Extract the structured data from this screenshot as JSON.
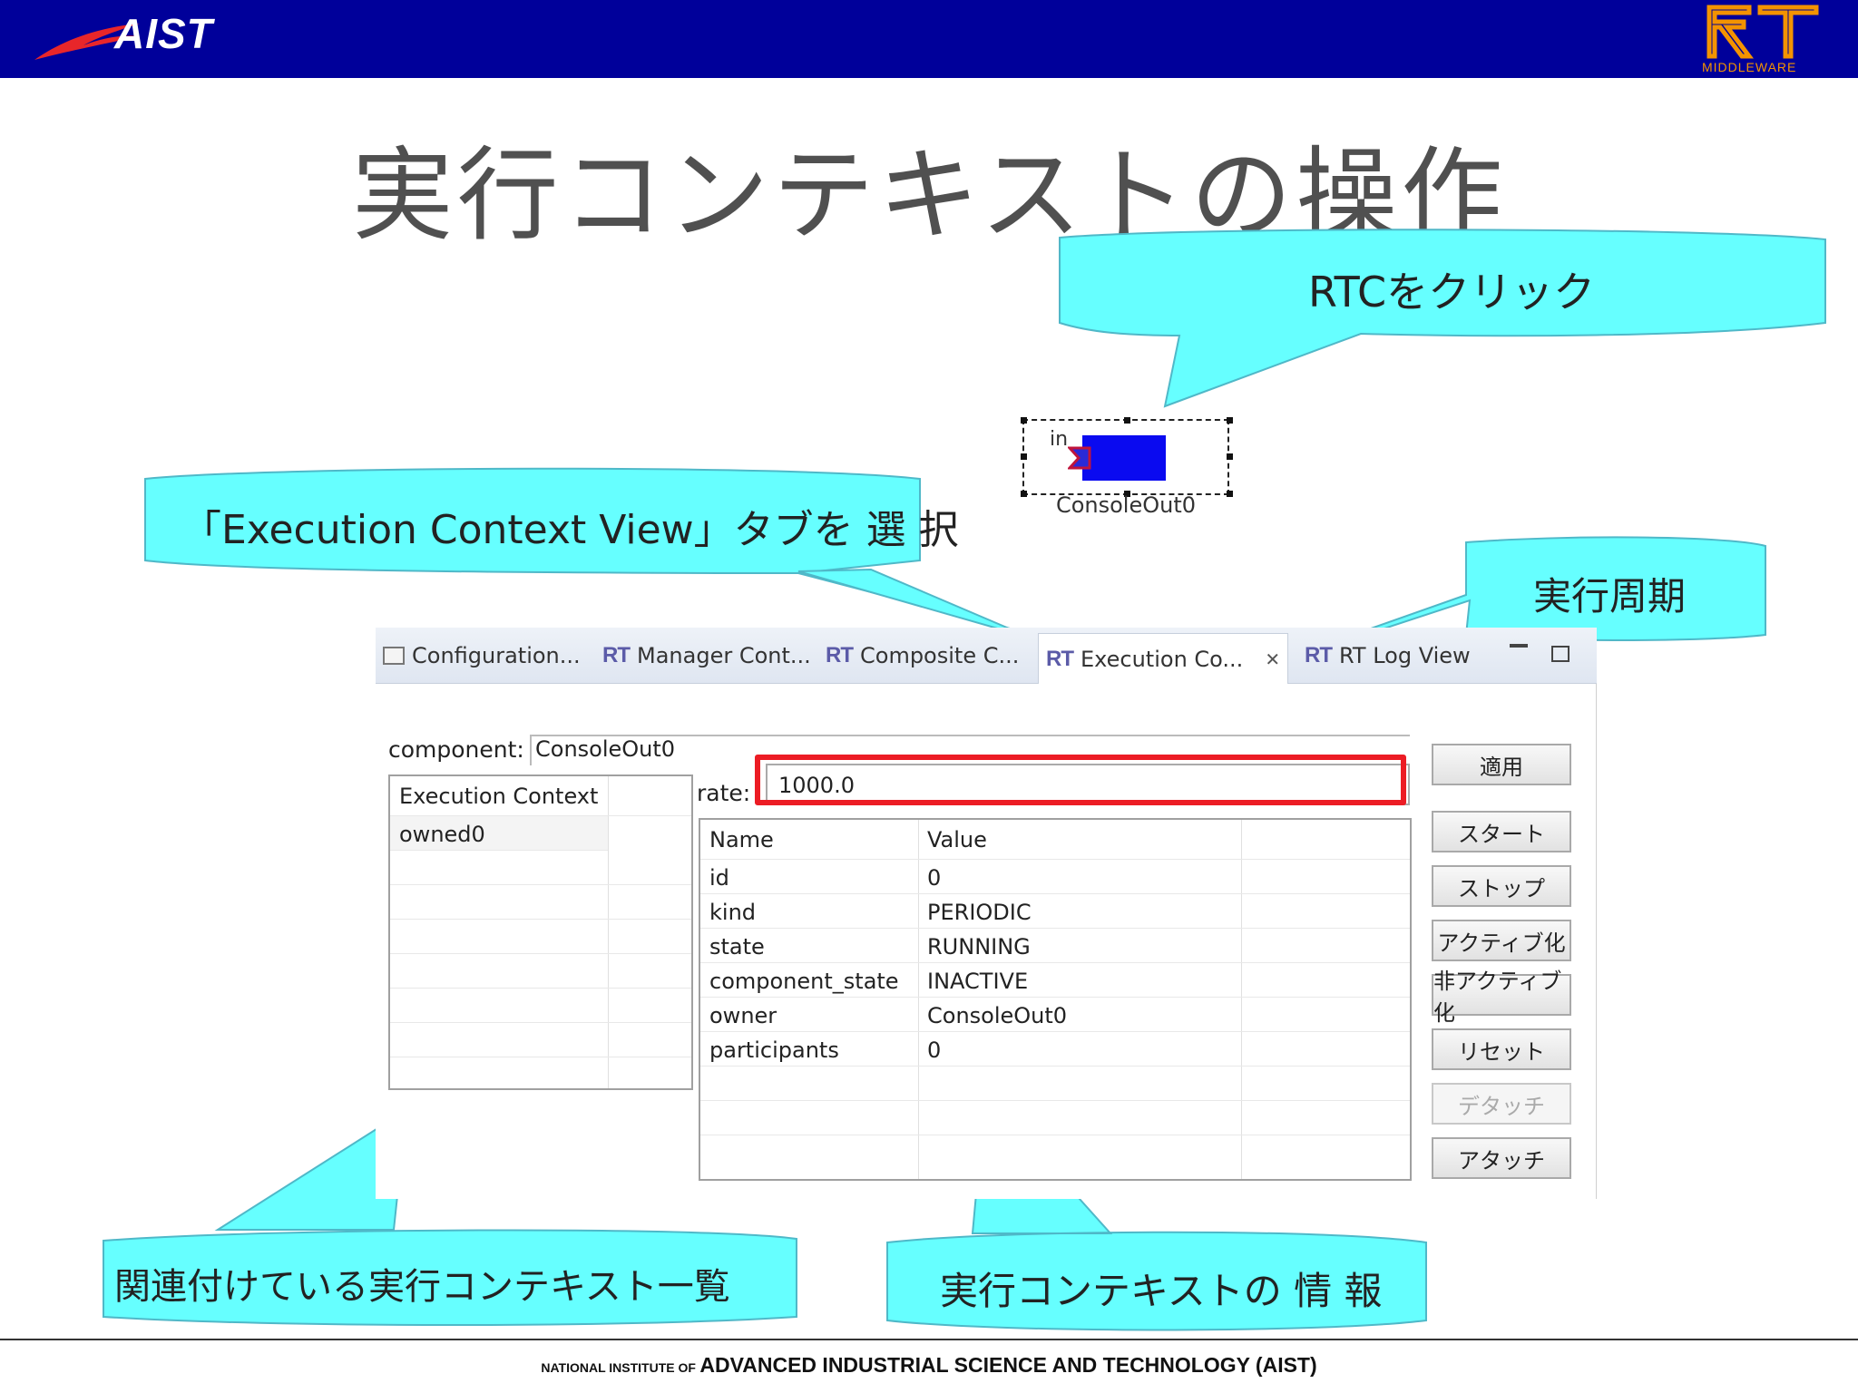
{
  "header": {
    "org_logo": "AIST",
    "rt_logo_sub": "MIDDLEWARE"
  },
  "slide": {
    "title": "実行コンテキストの操作"
  },
  "callouts": {
    "click_rtc": "RTCをクリック",
    "select_tab": "「Execution Context View」タブを 選 択",
    "period": "実行周期",
    "ec_list": "関連付けている実行コンテキスト一覧",
    "ec_info": "実行コンテキストの 情 報"
  },
  "rtc": {
    "port_label": "in",
    "name": "ConsoleOut0",
    "body_color": "#0a0af0"
  },
  "tabs": [
    {
      "label": "Configuration...",
      "icon": "config-icon"
    },
    {
      "label": "Manager Cont...",
      "icon": "rt-icon"
    },
    {
      "label": "Composite C...",
      "icon": "rt-icon"
    },
    {
      "label": "Execution Co...",
      "icon": "rt-icon",
      "active": true
    },
    {
      "label": "RT Log View",
      "icon": "rt-icon"
    }
  ],
  "rt_badge": "RT",
  "close_glyph": "✕",
  "form": {
    "component_label": "component:",
    "component_value": "ConsoleOut0",
    "rate_label": "rate:",
    "rate_value": "1000.0"
  },
  "ec_list": {
    "header": "Execution Context",
    "items": [
      "owned0"
    ]
  },
  "properties": {
    "headers": [
      "Name",
      "Value"
    ],
    "rows": [
      [
        "id",
        "0"
      ],
      [
        "kind",
        "PERIODIC"
      ],
      [
        "state",
        "RUNNING"
      ],
      [
        "component_state",
        "INACTIVE"
      ],
      [
        "owner",
        "ConsoleOut0"
      ],
      [
        "participants",
        "0"
      ]
    ]
  },
  "buttons": {
    "apply": "適用",
    "start": "スタート",
    "stop": "ストップ",
    "activate": "アクティブ化",
    "deactivate": "非アクティブ化",
    "reset": "リセット",
    "detach": "デタッチ",
    "attach": "アタッチ"
  },
  "footer": {
    "prefix": "NATIONAL INSTITUTE OF",
    "main": "ADVANCED INDUSTRIAL SCIENCE AND TECHNOLOGY (AIST)"
  },
  "colors": {
    "banner": "#00009a",
    "callout": "#66ffff",
    "highlight": "#ec1c24",
    "logo_red": "#e8262a",
    "rt_orange": "#f39300"
  }
}
